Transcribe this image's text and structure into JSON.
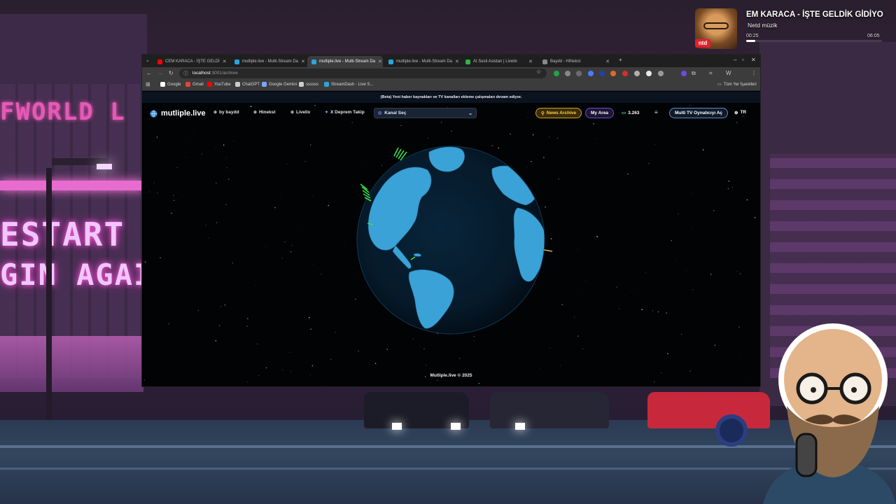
{
  "browser": {
    "tabs": [
      {
        "label": "CEM KARACA - İŞTE GELDİ",
        "favicon_color": "#ff0000",
        "active": false
      },
      {
        "label": "mutliple.live - Multi-Stream Da",
        "favicon_color": "#2aa6df",
        "active": false
      },
      {
        "label": "mutliple.live - Multi-Stream Da",
        "favicon_color": "#2aa6df",
        "active": true
      },
      {
        "label": "mutliple.live - Multi-Stream Da",
        "favicon_color": "#2aa6df",
        "active": false
      },
      {
        "label": "AI Sesli Asistan | Livelix",
        "favicon_color": "#33b24a",
        "active": false
      },
      {
        "label": "Baydd - HiNekst",
        "favicon_color": "#888888",
        "active": false
      }
    ],
    "url_host": "localhost",
    "url_path": ":3001/archive",
    "bookmarks": [
      {
        "label": "Google",
        "color": "#ffffff"
      },
      {
        "label": "Gmail",
        "color": "#ea4335"
      },
      {
        "label": "YouTube",
        "color": "#ff0000"
      },
      {
        "label": "ChatGPT",
        "color": "#cccccc"
      },
      {
        "label": "Google Gemini",
        "color": "#7aa7ff"
      },
      {
        "label": "ssssss",
        "color": "#cccccc"
      },
      {
        "label": "StreamDash - Live S...",
        "color": "#2aa6df"
      }
    ],
    "all_bookmarks": "Tüm Yer İşaretleri"
  },
  "site": {
    "beta_banner": "(Beta) Yeni haber kaynakları ve TV kanalları ekleme çalışmaları devam ediyor.",
    "logo": "mutliple.live",
    "nav_links": [
      {
        "label": "by baydd",
        "icon": "globe-icon"
      },
      {
        "label": "Hinekst",
        "icon": "globe-icon"
      },
      {
        "label": "Livelix",
        "icon": "globe-icon"
      },
      {
        "label": "X Deprem Takip",
        "icon": "twitter-icon"
      }
    ],
    "channel_select": "Kanal Seç",
    "news_archive": "News Archive",
    "my_area": "My Area",
    "viewer_count": "3.263",
    "multi_tv": "Multi TV Oynatıcıyı Aç",
    "lang": "TR",
    "footer": "Mutliple.live © 2025"
  },
  "music": {
    "title": "EM KARACA - İŞTE GELDİK GİDİYO",
    "artist": "Netd müzik",
    "label_badge": "ntd",
    "elapsed": "00:25",
    "duration": "06:05",
    "progress": 0.068
  },
  "background": {
    "sign_top": "FWORLD L",
    "sign_mid": "ESTART",
    "sign_bot": "GIN AGAIN"
  }
}
